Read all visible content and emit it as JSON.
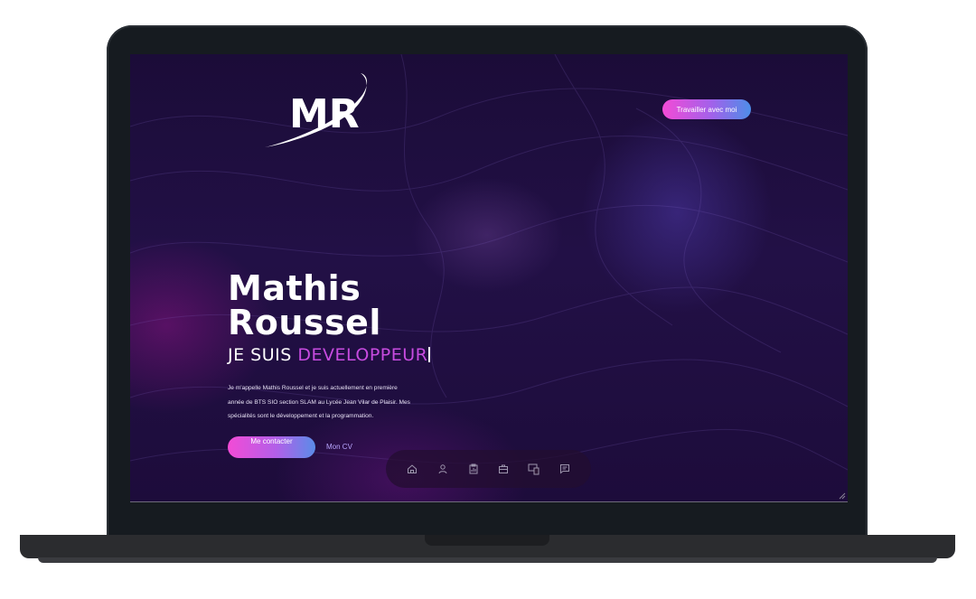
{
  "header": {
    "logo_text": "MR",
    "cta_label": "Travailler avec moi"
  },
  "hero": {
    "first_name": "Mathis",
    "last_name": "Roussel",
    "role_prefix": "JE SUIS",
    "role_word": "DEVELOPPEUR",
    "intro_line_1": "Je m'appelle Mathis Roussel et je suis actuellement en première",
    "intro_line_2": "année de BTS SIO section SLAM au Lycée Jean Vilar de Plaisir. Mes",
    "intro_line_3": "spécialités sont le développement et la programmation.",
    "contact_label": "Me contacter",
    "cv_label": "Mon CV"
  },
  "dock": {
    "items": [
      "home-icon",
      "user-icon",
      "clipboard-icon",
      "briefcase-icon",
      "devices-icon",
      "message-icon"
    ]
  },
  "colors": {
    "accent_pink": "#f34bd6",
    "accent_blue": "#4d8ee8",
    "role_highlight": "#c74be0",
    "background": "#1c0f3a"
  }
}
